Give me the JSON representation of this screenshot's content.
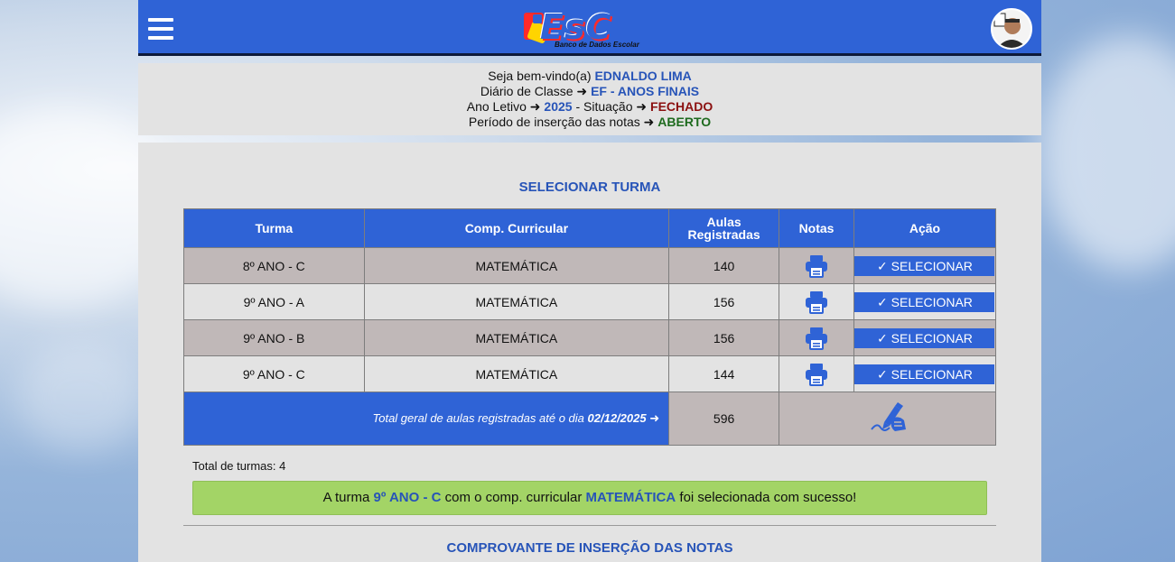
{
  "header": {
    "logo_text": "EsC",
    "logo_subtitle": "Banco de Dados Escolar",
    "menu_icon": "hamburger-icon",
    "avatar_icon": "user-avatar"
  },
  "info": {
    "welcome_label": "Seja bem-vindo(a)",
    "user_name": "EDNALDO LIMA",
    "diary_label": "Diário de Classe ➜",
    "diary_value": "EF - ANOS FINAIS",
    "year_label": "Ano Letivo ➜",
    "year_value": "2025",
    "situation_label": "- Situação ➜",
    "situation_value": "FECHADO",
    "period_label": "Período de inserção das notas ➜",
    "period_value": "ABERTO"
  },
  "section_title": "SELECIONAR TURMA",
  "table": {
    "headers": [
      "Turma",
      "Comp. Curricular",
      "Aulas Registradas",
      "Notas",
      "Ação"
    ],
    "rows": [
      {
        "turma": "8º ANO - C",
        "comp": "MATEMÁTICA",
        "aulas": "140",
        "action": "✓ SELECIONAR"
      },
      {
        "turma": "9º ANO - A",
        "comp": "MATEMÁTICA",
        "aulas": "156",
        "action": "✓ SELECIONAR"
      },
      {
        "turma": "9º ANO - B",
        "comp": "MATEMÁTICA",
        "aulas": "156",
        "action": "✓ SELECIONAR"
      },
      {
        "turma": "9º ANO - C",
        "comp": "MATEMÁTICA",
        "aulas": "144",
        "action": "✓ SELECIONAR"
      }
    ],
    "total_label": "Total geral de aulas registradas até o dia",
    "total_date": "02/12/2025 ➜",
    "total_value": "596"
  },
  "count_text": "Total de turmas: 4",
  "success": {
    "prefix": "A turma",
    "turma": "9º ANO - C",
    "middle": "com o comp. curricular",
    "comp": "MATEMÁTICA",
    "suffix": "foi selecionada com sucesso!"
  },
  "section2_title": "COMPROVANTE DE INSERÇÃO DAS NOTAS",
  "colors": {
    "primary": "#2f63d6",
    "dark_row": "#c0b8b8",
    "light_row": "#e3e3e3",
    "success_bg": "#a3d466",
    "blue_text": "#2754b8"
  }
}
